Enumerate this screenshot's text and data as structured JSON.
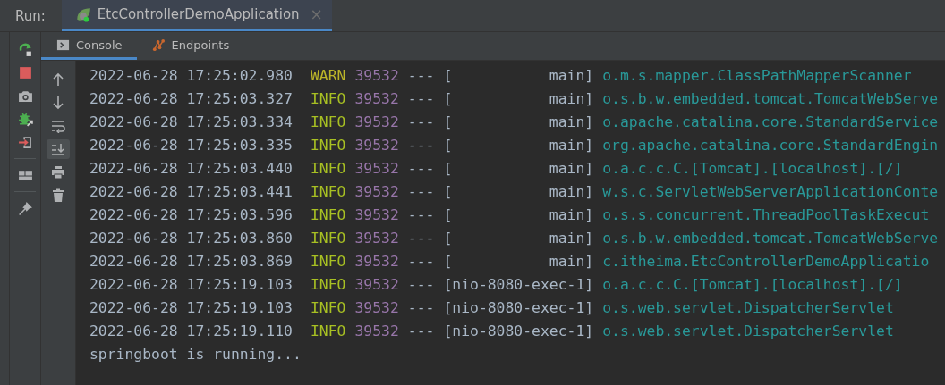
{
  "run_bar": {
    "label": "Run:",
    "tabs": [
      {
        "title": "EtcControllerDemoApplication",
        "selected": true,
        "close": "×"
      }
    ]
  },
  "console_tabs": [
    {
      "label": "Console",
      "kind": "console",
      "selected": true
    },
    {
      "label": "Endpoints",
      "kind": "endpoints",
      "selected": false
    }
  ],
  "left_toolbar": [
    {
      "kind": "rerun"
    },
    {
      "kind": "stop"
    },
    {
      "kind": "camera"
    },
    {
      "kind": "debug"
    },
    {
      "kind": "exit"
    },
    {
      "kind": "separator"
    },
    {
      "kind": "layout"
    },
    {
      "kind": "separator"
    },
    {
      "kind": "pin"
    }
  ],
  "console_toolbar": [
    {
      "kind": "up",
      "selected": false
    },
    {
      "kind": "down",
      "selected": false
    },
    {
      "kind": "wrap",
      "selected": false
    },
    {
      "kind": "scroll-end",
      "selected": true
    },
    {
      "kind": "print",
      "selected": false
    },
    {
      "kind": "trash",
      "selected": false
    }
  ],
  "log_lines": [
    {
      "timestamp": "2022-06-28 17:25:02.980",
      "level": "WARN",
      "pid": "39532",
      "separator": "---",
      "thread": "[           main]",
      "logger": "o.m.s.mapper.ClassPathMapperScanner"
    },
    {
      "timestamp": "2022-06-28 17:25:03.327",
      "level": "INFO",
      "pid": "39532",
      "separator": "---",
      "thread": "[           main]",
      "logger": "o.s.b.w.embedded.tomcat.TomcatWebServe"
    },
    {
      "timestamp": "2022-06-28 17:25:03.334",
      "level": "INFO",
      "pid": "39532",
      "separator": "---",
      "thread": "[           main]",
      "logger": "o.apache.catalina.core.StandardService"
    },
    {
      "timestamp": "2022-06-28 17:25:03.335",
      "level": "INFO",
      "pid": "39532",
      "separator": "---",
      "thread": "[           main]",
      "logger": "org.apache.catalina.core.StandardEngin"
    },
    {
      "timestamp": "2022-06-28 17:25:03.440",
      "level": "INFO",
      "pid": "39532",
      "separator": "---",
      "thread": "[           main]",
      "logger": "o.a.c.c.C.[Tomcat].[localhost].[/]"
    },
    {
      "timestamp": "2022-06-28 17:25:03.441",
      "level": "INFO",
      "pid": "39532",
      "separator": "---",
      "thread": "[           main]",
      "logger": "w.s.c.ServletWebServerApplicationConte"
    },
    {
      "timestamp": "2022-06-28 17:25:03.596",
      "level": "INFO",
      "pid": "39532",
      "separator": "---",
      "thread": "[           main]",
      "logger": "o.s.s.concurrent.ThreadPoolTaskExecut"
    },
    {
      "timestamp": "2022-06-28 17:25:03.860",
      "level": "INFO",
      "pid": "39532",
      "separator": "---",
      "thread": "[           main]",
      "logger": "o.s.b.w.embedded.tomcat.TomcatWebServe"
    },
    {
      "timestamp": "2022-06-28 17:25:03.869",
      "level": "INFO",
      "pid": "39532",
      "separator": "---",
      "thread": "[           main]",
      "logger": "c.itheima.EtcControllerDemoApplicatio"
    },
    {
      "timestamp": "2022-06-28 17:25:19.103",
      "level": "INFO",
      "pid": "39532",
      "separator": "---",
      "thread": "[nio-8080-exec-1]",
      "logger": "o.a.c.c.C.[Tomcat].[localhost].[/]"
    },
    {
      "timestamp": "2022-06-28 17:25:19.103",
      "level": "INFO",
      "pid": "39532",
      "separator": "---",
      "thread": "[nio-8080-exec-1]",
      "logger": "o.s.web.servlet.DispatcherServlet"
    },
    {
      "timestamp": "2022-06-28 17:25:19.110",
      "level": "INFO",
      "pid": "39532",
      "separator": "---",
      "thread": "[nio-8080-exec-1]",
      "logger": "o.s.web.servlet.DispatcherServlet"
    }
  ],
  "output_lines": [
    "springboot is running..."
  ]
}
